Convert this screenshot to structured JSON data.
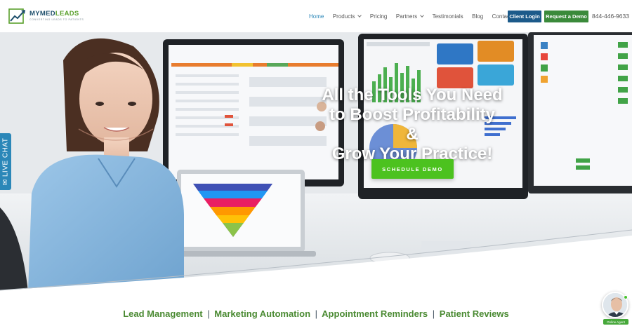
{
  "brand": {
    "name_part1": "MYMED",
    "name_part2": "LEADS",
    "tagline": "CONVERTING LEADS TO PATIENTS"
  },
  "nav": {
    "items": [
      {
        "label": "Home",
        "active": true,
        "has_dropdown": false
      },
      {
        "label": "Products",
        "active": false,
        "has_dropdown": true
      },
      {
        "label": "Pricing",
        "active": false,
        "has_dropdown": false
      },
      {
        "label": "Partners",
        "active": false,
        "has_dropdown": true
      },
      {
        "label": "Testimonials",
        "active": false,
        "has_dropdown": false
      },
      {
        "label": "Blog",
        "active": false,
        "has_dropdown": false
      },
      {
        "label": "Contact",
        "active": false,
        "has_dropdown": false
      }
    ],
    "client_login": "Client Login",
    "request_demo": "Request a Demo",
    "phone": "844-446-9633"
  },
  "hero": {
    "headline_line1": "All the Tools You Need",
    "headline_line2": "to Boost Profitability &",
    "headline_line3": "Grow Your Practice!",
    "cta_label": "SCHEDULE DEMO"
  },
  "livechat": {
    "label": "LIVE CHAT",
    "icon": "chat-bubble-icon"
  },
  "services": {
    "items": [
      "Lead Management",
      "Marketing Automation",
      "Appointment Reminders",
      "Patient Reviews"
    ],
    "separator": "|"
  },
  "agent": {
    "badge": "Online Agent"
  },
  "colors": {
    "nav_active": "#2b87b8",
    "login_button": "#1c5a8a",
    "demo_button": "#3a8a3a",
    "cta": "#4cc21f",
    "services_text": "#4a8a32",
    "livechat": "#2b87b8"
  }
}
